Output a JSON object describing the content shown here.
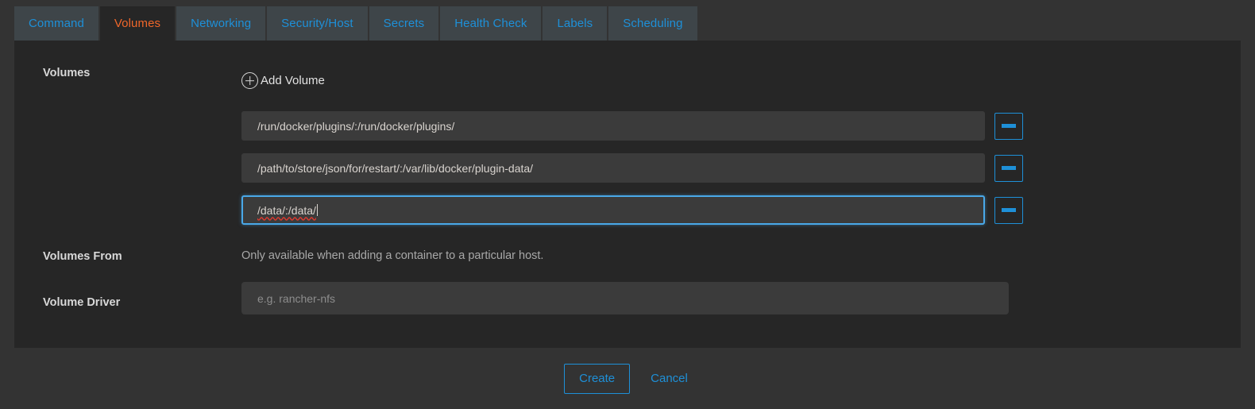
{
  "tabs": [
    {
      "label": "Command",
      "active": false
    },
    {
      "label": "Volumes",
      "active": true
    },
    {
      "label": "Networking",
      "active": false
    },
    {
      "label": "Security/Host",
      "active": false
    },
    {
      "label": "Secrets",
      "active": false
    },
    {
      "label": "Health Check",
      "active": false
    },
    {
      "label": "Labels",
      "active": false
    },
    {
      "label": "Scheduling",
      "active": false
    }
  ],
  "form": {
    "volumes": {
      "label": "Volumes",
      "add_button_label": "Add Volume",
      "add_button_icon": "plus-circle-icon",
      "remove_button_icon": "minus-icon",
      "rows": [
        {
          "value": "/run/docker/plugins/:/run/docker/plugins/",
          "focused": false
        },
        {
          "value": "/path/to/store/json/for/restart/:/var/lib/docker/plugin-data/",
          "focused": false
        },
        {
          "value": "/data/:/data/",
          "focused": true
        }
      ]
    },
    "volumes_from": {
      "label": "Volumes From",
      "help_text": "Only available when adding a container to a particular host."
    },
    "volume_driver": {
      "label": "Volume Driver",
      "value": "",
      "placeholder": "e.g. rancher-nfs"
    }
  },
  "footer": {
    "create_label": "Create",
    "cancel_label": "Cancel"
  },
  "colors": {
    "accent_blue": "#1e90d8",
    "focus_blue": "#49a8e8",
    "active_tab_orange": "#f0672a",
    "panel_bg": "#262626",
    "page_bg": "#333333",
    "tab_bg": "#3e4549",
    "input_bg": "#3b3b3b",
    "spellcheck_red": "#e03a2f"
  }
}
